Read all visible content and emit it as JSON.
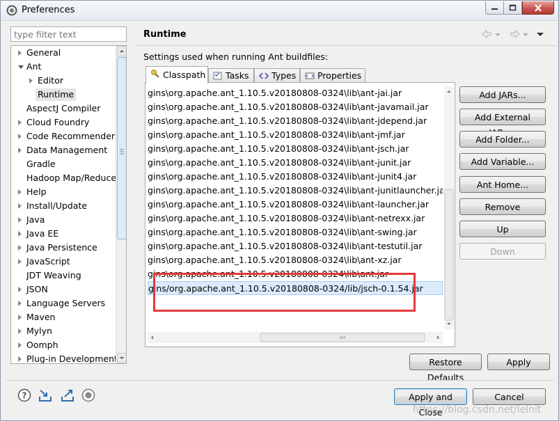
{
  "window": {
    "title": "Preferences"
  },
  "filter": {
    "placeholder": "type filter text"
  },
  "tree": [
    {
      "label": "General",
      "depth": 0,
      "state": "collapsed"
    },
    {
      "label": "Ant",
      "depth": 0,
      "state": "expanded"
    },
    {
      "label": "Editor",
      "depth": 1,
      "state": "collapsed"
    },
    {
      "label": "Runtime",
      "depth": 1,
      "state": "leaf",
      "selected": true
    },
    {
      "label": "AspectJ Compiler",
      "depth": 0,
      "state": "leaf"
    },
    {
      "label": "Cloud Foundry",
      "depth": 0,
      "state": "collapsed"
    },
    {
      "label": "Code Recommenders",
      "depth": 0,
      "state": "collapsed"
    },
    {
      "label": "Data Management",
      "depth": 0,
      "state": "collapsed"
    },
    {
      "label": "Gradle",
      "depth": 0,
      "state": "leaf"
    },
    {
      "label": "Hadoop Map/Reduce",
      "depth": 0,
      "state": "leaf"
    },
    {
      "label": "Help",
      "depth": 0,
      "state": "collapsed"
    },
    {
      "label": "Install/Update",
      "depth": 0,
      "state": "collapsed"
    },
    {
      "label": "Java",
      "depth": 0,
      "state": "collapsed"
    },
    {
      "label": "Java EE",
      "depth": 0,
      "state": "collapsed"
    },
    {
      "label": "Java Persistence",
      "depth": 0,
      "state": "collapsed"
    },
    {
      "label": "JavaScript",
      "depth": 0,
      "state": "collapsed"
    },
    {
      "label": "JDT Weaving",
      "depth": 0,
      "state": "leaf"
    },
    {
      "label": "JSON",
      "depth": 0,
      "state": "collapsed"
    },
    {
      "label": "Language Servers",
      "depth": 0,
      "state": "collapsed"
    },
    {
      "label": "Maven",
      "depth": 0,
      "state": "collapsed"
    },
    {
      "label": "Mylyn",
      "depth": 0,
      "state": "collapsed"
    },
    {
      "label": "Oomph",
      "depth": 0,
      "state": "collapsed"
    },
    {
      "label": "Plug-in Development",
      "depth": 0,
      "state": "collapsed"
    }
  ],
  "page": {
    "title": "Runtime",
    "description": "Settings used when running Ant buildfiles:"
  },
  "tabs": [
    {
      "label": "Classpath",
      "icon": "classpath-icon",
      "active": true
    },
    {
      "label": "Tasks",
      "icon": "tasks-icon",
      "active": false
    },
    {
      "label": "Types",
      "icon": "types-icon",
      "active": false
    },
    {
      "label": "Properties",
      "icon": "properties-icon",
      "active": false
    }
  ],
  "classpath_entries": [
    "gins\\org.apache.ant_1.10.5.v20180808-0324\\lib\\ant-jai.jar",
    "gins\\org.apache.ant_1.10.5.v20180808-0324\\lib\\ant-javamail.jar",
    "gins\\org.apache.ant_1.10.5.v20180808-0324\\lib\\ant-jdepend.jar",
    "gins\\org.apache.ant_1.10.5.v20180808-0324\\lib\\ant-jmf.jar",
    "gins\\org.apache.ant_1.10.5.v20180808-0324\\lib\\ant-jsch.jar",
    "gins\\org.apache.ant_1.10.5.v20180808-0324\\lib\\ant-junit.jar",
    "gins\\org.apache.ant_1.10.5.v20180808-0324\\lib\\ant-junit4.jar",
    "gins\\org.apache.ant_1.10.5.v20180808-0324\\lib\\ant-junitlauncher.jar",
    "gins\\org.apache.ant_1.10.5.v20180808-0324\\lib\\ant-launcher.jar",
    "gins\\org.apache.ant_1.10.5.v20180808-0324\\lib\\ant-netrexx.jar",
    "gins\\org.apache.ant_1.10.5.v20180808-0324\\lib\\ant-swing.jar",
    "gins\\org.apache.ant_1.10.5.v20180808-0324\\lib\\ant-testutil.jar",
    "gins\\org.apache.ant_1.10.5.v20180808-0324\\lib\\ant-xz.jar",
    "gins\\org.apache.ant_1.10.5.v20180808-0324\\lib\\ant.jar",
    "gins/org.apache.ant_1.10.5.v20180808-0324/lib/jsch-0.1.54.jar"
  ],
  "selected_entry_index": 14,
  "side_buttons": {
    "add_jars": "Add JARs...",
    "add_external_jars": "Add External JARs...",
    "add_folder": "Add Folder...",
    "add_variable": "Add Variable...",
    "ant_home": "Ant Home...",
    "remove": "Remove",
    "up": "Up",
    "down": "Down"
  },
  "buttons": {
    "restore_defaults": "Restore Defaults",
    "apply": "Apply",
    "apply_and_close": "Apply and Close",
    "cancel": "Cancel"
  },
  "bottom_icons": [
    "help-icon",
    "import-icon",
    "export-icon",
    "record-icon"
  ],
  "watermark": "https://blog.csdn.net/lelnit",
  "colors": {
    "selection": "#dcebfc",
    "highlight_box": "#e4393c",
    "scroll_thumb": "#dcebf8"
  }
}
